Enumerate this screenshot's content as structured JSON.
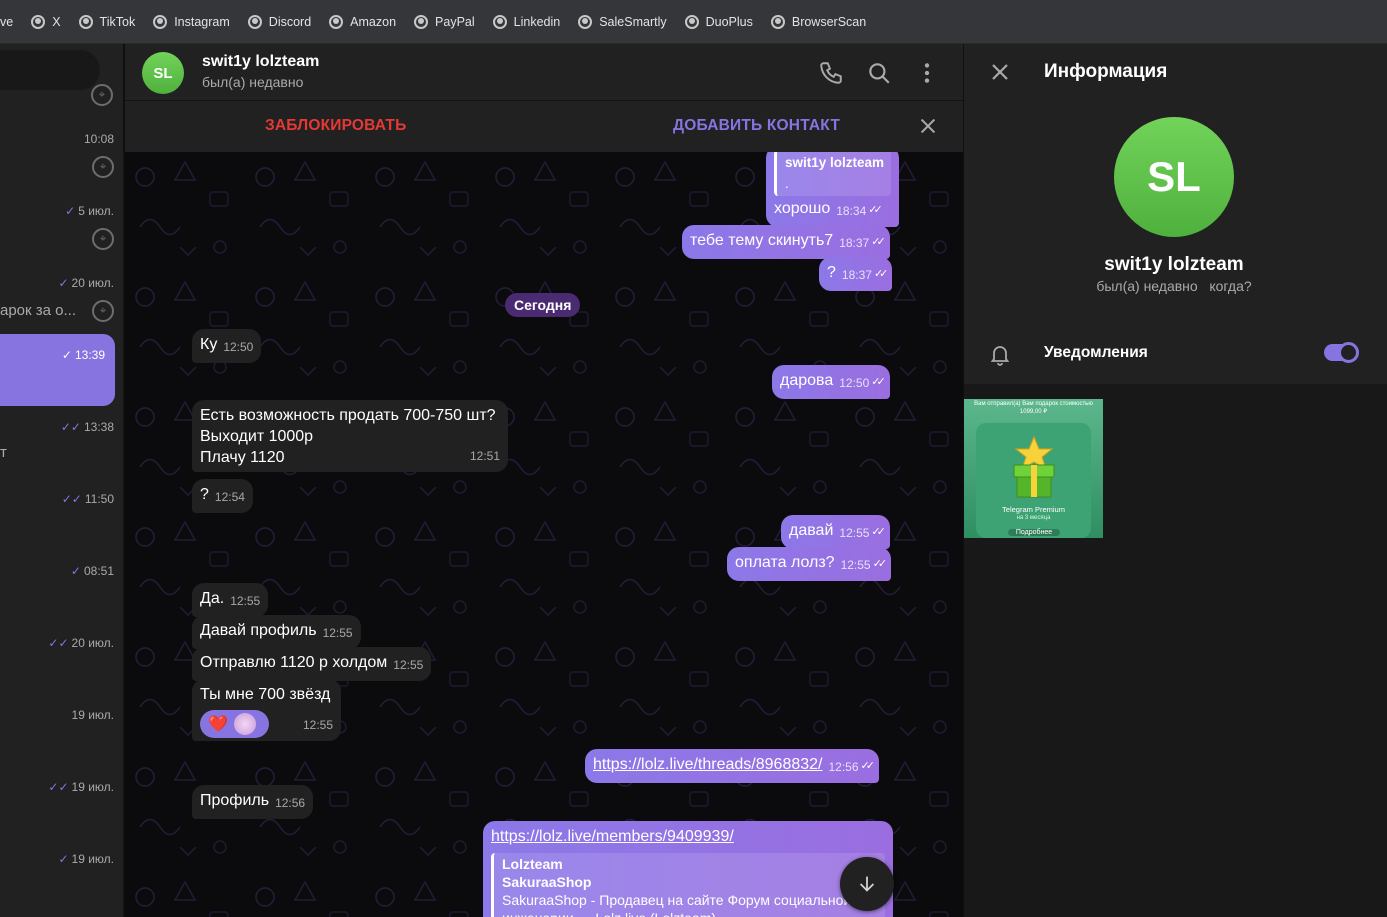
{
  "bookmarks": [
    {
      "label": "ve"
    },
    {
      "label": "X"
    },
    {
      "label": "TikTok"
    },
    {
      "label": "Instagram"
    },
    {
      "label": "Discord"
    },
    {
      "label": "Amazon"
    },
    {
      "label": "PayPal"
    },
    {
      "label": "Linkedin"
    },
    {
      "label": "SaleSmartly"
    },
    {
      "label": "DuoPlus"
    },
    {
      "label": "BrowserScan"
    }
  ],
  "chatlist": {
    "items": [
      {
        "time": "10:08",
        "check": ""
      },
      {
        "time": "5 июл.",
        "check": "✓"
      },
      {
        "time": "20 июл.",
        "check": "✓",
        "snippet": "арок за о..."
      },
      {
        "time": "13:39",
        "check": "✓"
      },
      {
        "time": "13:38",
        "check": "✓✓",
        "snippet": "т"
      },
      {
        "time": "11:50",
        "check": "✓✓"
      },
      {
        "time": "08:51",
        "check": "✓"
      },
      {
        "time": "20 июл.",
        "check": "✓✓"
      },
      {
        "time": "19 июл.",
        "check": ""
      },
      {
        "time": "19 июл.",
        "check": "✓✓"
      },
      {
        "time": "19 июл.",
        "check": "✓"
      }
    ]
  },
  "header": {
    "avatar_initials": "SL",
    "name": "swit1y lolzteam",
    "status": "был(а) недавно"
  },
  "actionbar": {
    "block_label": "ЗАБЛОКИРОВАТЬ",
    "add_label": "ДОБАВИТЬ КОНТАКТ"
  },
  "messages": {
    "date_separator": "Сегодня",
    "out_quote": {
      "reply_name": "swit1y lolzteam",
      "reply_text": ".",
      "text": "хорошо",
      "time": "18:34"
    },
    "out_1": {
      "text": "тебе тему скинуть7",
      "time": "18:37"
    },
    "out_2": {
      "text": "?",
      "time": "18:37"
    },
    "in_1": {
      "text": "Ку",
      "time": "12:50"
    },
    "out_3": {
      "text": "дарова",
      "time": "12:50"
    },
    "in_2": {
      "line1": "Есть возможность продать 700-750 шт?",
      "line2": "Выходит 1000р",
      "line3": "Плачу 1120",
      "time": "12:51"
    },
    "in_3": {
      "text": "?",
      "time": "12:54"
    },
    "out_4": {
      "text": "давай",
      "time": "12:55"
    },
    "out_5": {
      "text": "оплата лолз?",
      "time": "12:55"
    },
    "in_4": {
      "text": "Да.",
      "time": "12:55"
    },
    "in_5": {
      "text": "Давай профиль",
      "time": "12:55"
    },
    "in_6": {
      "text": "Отправлю 1120 р холдом",
      "time": "12:55"
    },
    "in_7": {
      "text": "Ты мне 700 звёзд",
      "time": "12:55",
      "reaction": "❤️"
    },
    "out_6": {
      "text": "https://lolz.live/threads/8968832/",
      "time": "12:56"
    },
    "in_8": {
      "text": "Профиль",
      "time": "12:56"
    },
    "out_7": {
      "link": "https://lolz.live/members/9409939/",
      "preview_site": "Lolzteam",
      "preview_title": "SakuraaShop",
      "preview_desc1": "SakuraaShop - Продавец на сайте Форум социальной",
      "preview_desc2": "инженерии — Lolz.live (Lolzteam)"
    }
  },
  "infopanel": {
    "title": "Информация",
    "avatar_initials": "SL",
    "name": "swit1y lolzteam",
    "status": "был(а) недавно   когда?",
    "notifications_label": "Уведомления",
    "notifications_on": true,
    "media": {
      "caption_top": "Вам отправил(а) Вам подарок стоимостью 1099,00 ₽",
      "caption_main": "Telegram Premium",
      "caption_sub": "на 3 месяца",
      "button": "Подробнее"
    }
  },
  "colors": {
    "accent": "#8774e1",
    "danger": "#e53935",
    "avatar_green": "#5cc245",
    "panel_bg": "#212121"
  }
}
